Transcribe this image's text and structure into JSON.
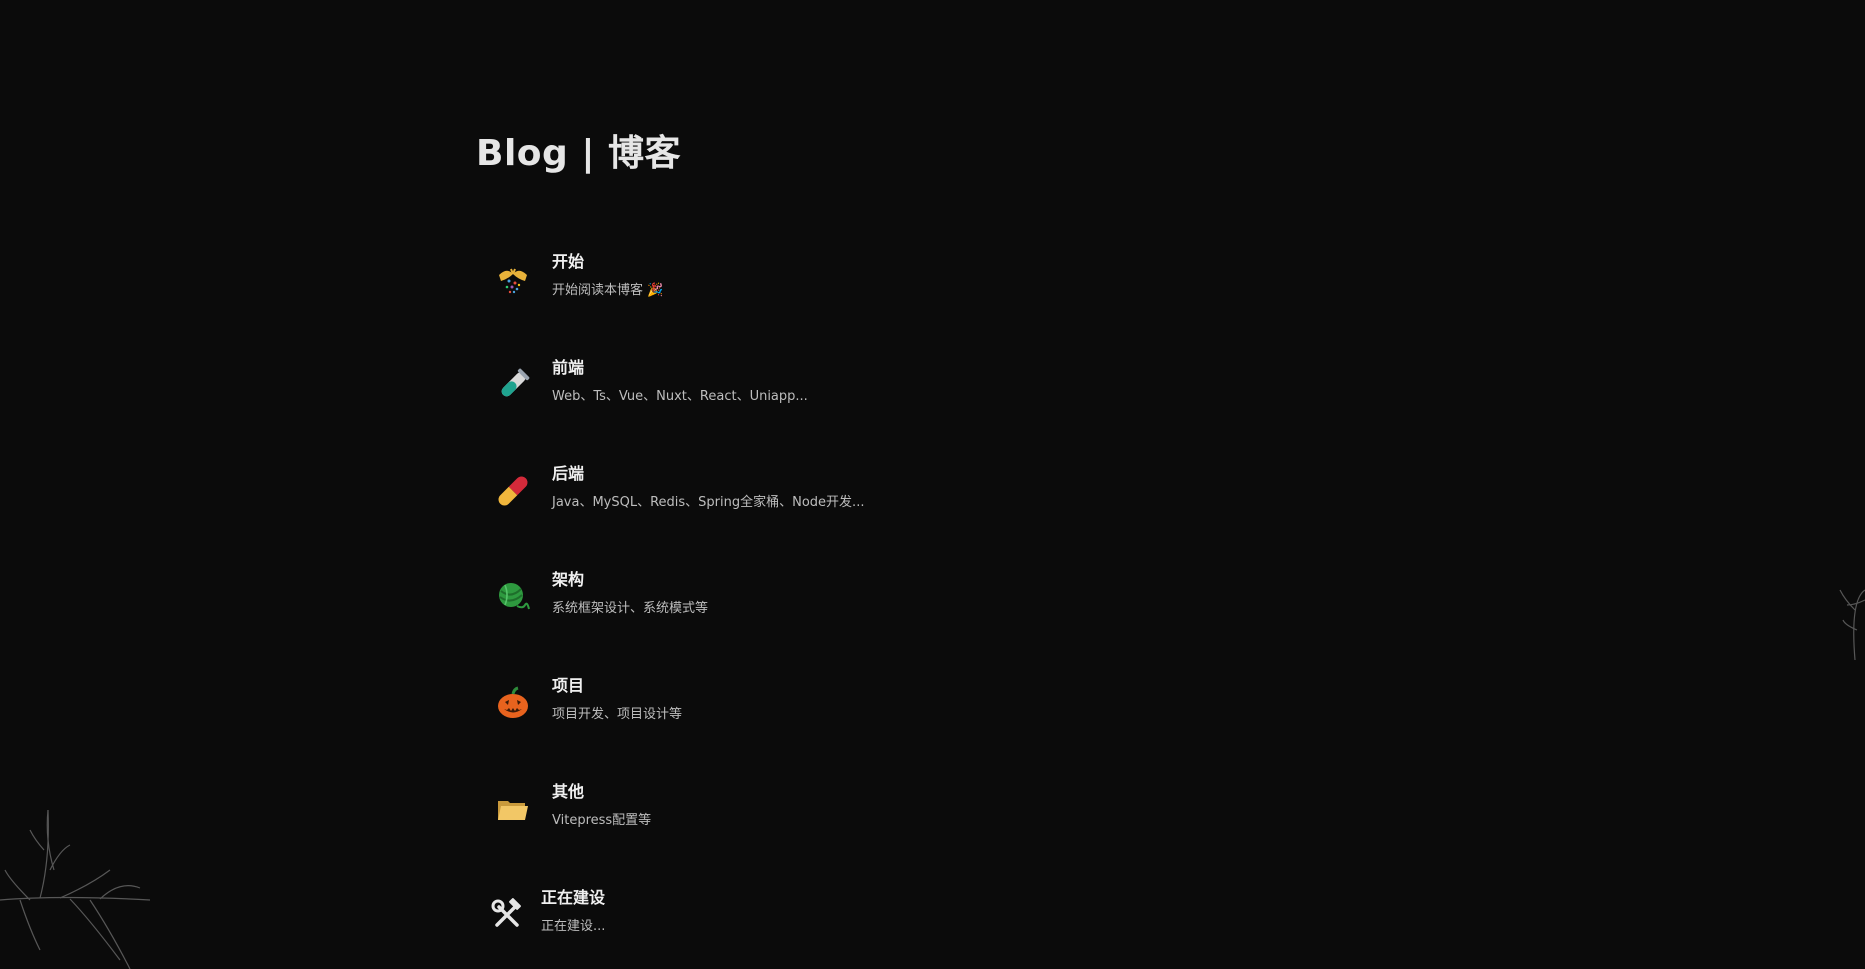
{
  "page": {
    "title": "Blog | 博客"
  },
  "items": [
    {
      "title": "开始",
      "desc": "开始阅读本博客 🎉",
      "icon": "party-popper-icon"
    },
    {
      "title": "前端",
      "desc": "Web、Ts、Vue、Nuxt、React、Uniapp...",
      "icon": "test-tube-icon"
    },
    {
      "title": "后端",
      "desc": "Java、MySQL、Redis、Spring全家桶、Node开发...",
      "icon": "pill-icon"
    },
    {
      "title": "架构",
      "desc": "系统框架设计、系统模式等",
      "icon": "yarn-icon"
    },
    {
      "title": "项目",
      "desc": "项目开发、项目设计等",
      "icon": "jack-o-lantern-icon"
    },
    {
      "title": "其他",
      "desc": "Vitepress配置等",
      "icon": "folder-icon"
    },
    {
      "title": "正在建设",
      "desc": "正在建设...",
      "icon": "hammer-and-wrench-icon"
    }
  ],
  "colors": {
    "background": "#0b0b0b",
    "title": "#e6e6e6",
    "desc": "#bdbdbd"
  }
}
